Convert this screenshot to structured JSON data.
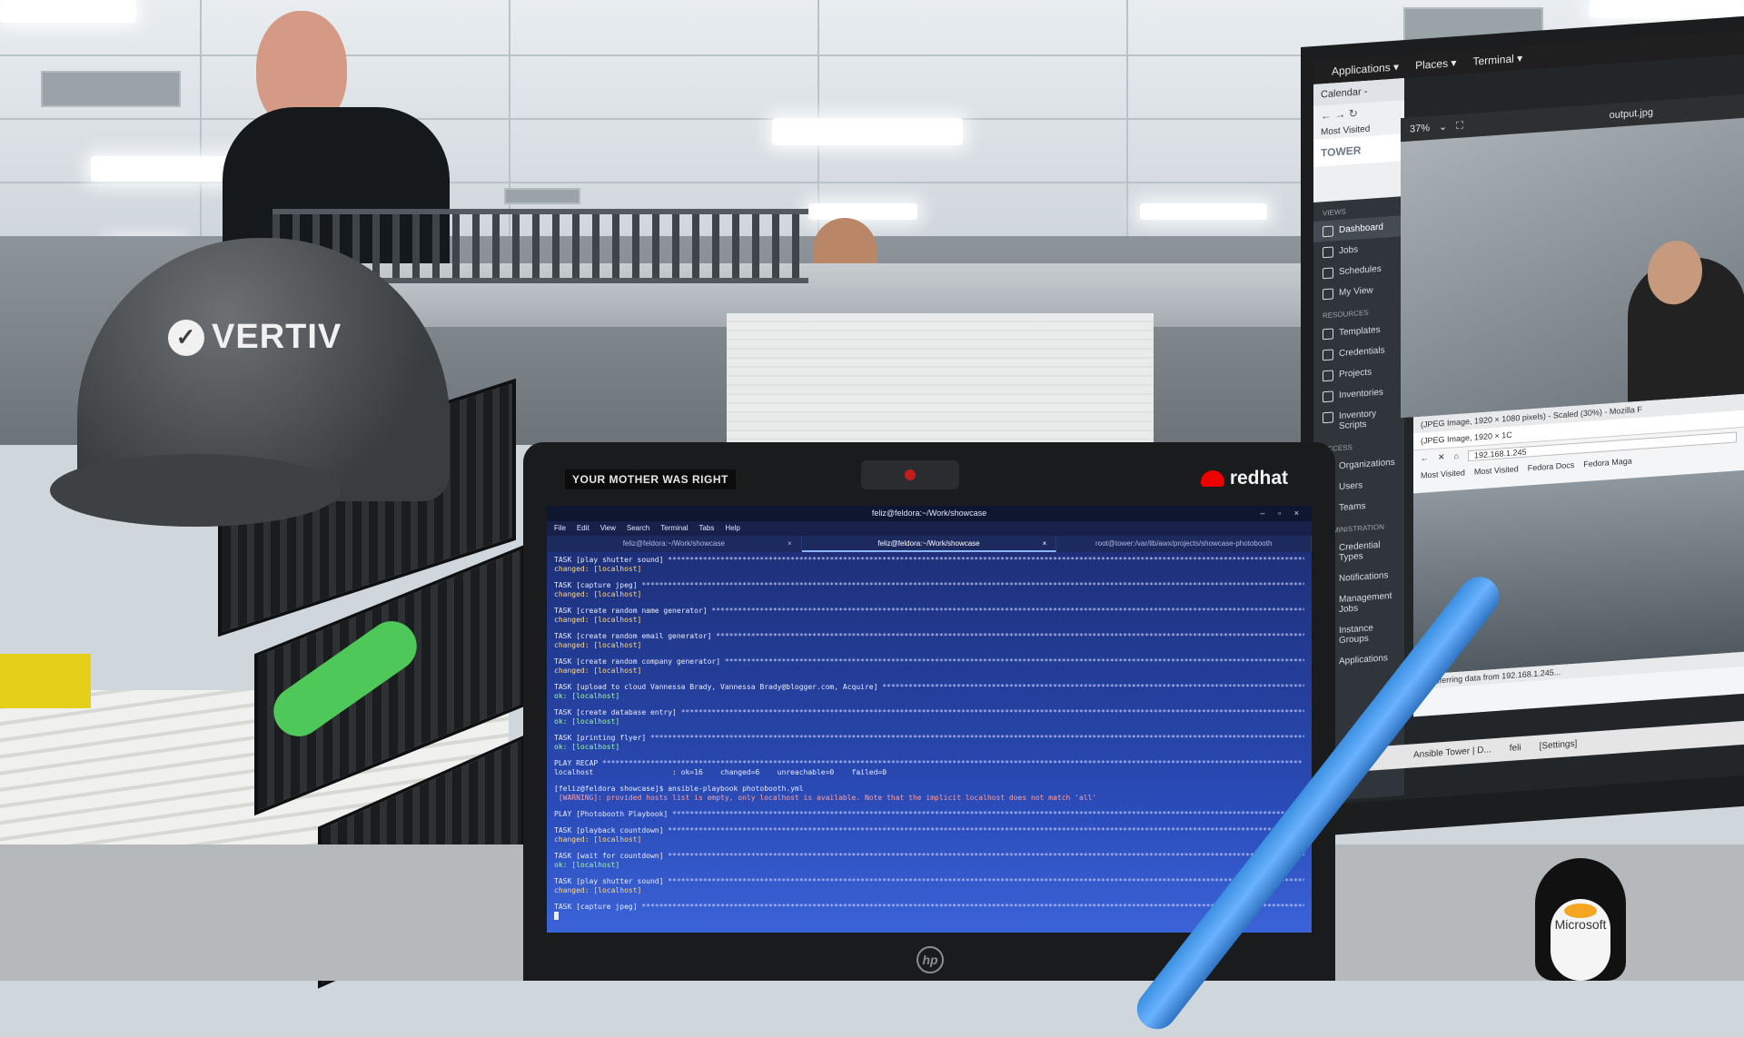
{
  "cap": {
    "brand": "VERTIV"
  },
  "laptop": {
    "sticker": "YOUR MOTHER WAS RIGHT",
    "brand_logo": "redhat",
    "maker_logo": "hp",
    "terminal": {
      "title": "feliz@feldora:~/Work/showcase",
      "window_controls": "– ▫ ×",
      "menu": [
        "File",
        "Edit",
        "View",
        "Search",
        "Terminal",
        "Tabs",
        "Help"
      ],
      "tabs": [
        {
          "label": "feliz@feldora:~/Work/showcase",
          "close": "×"
        },
        {
          "label": "feliz@feldora:~/Work/showcase",
          "close": "×",
          "active": true
        },
        {
          "label": "root@tower:/var/lib/awx/projects/showcase-photobooth",
          "close": ""
        }
      ],
      "lines": [
        {
          "text": "TASK [play shutter sound] ",
          "kind": "task"
        },
        {
          "text": "changed: [localhost]",
          "kind": "changed"
        },
        {
          "text": "",
          "kind": "gap"
        },
        {
          "text": "TASK [capture jpeg] ",
          "kind": "task"
        },
        {
          "text": "changed: [localhost]",
          "kind": "changed"
        },
        {
          "text": "",
          "kind": "gap"
        },
        {
          "text": "TASK [create random name generator] ",
          "kind": "task"
        },
        {
          "text": "changed: [localhost]",
          "kind": "changed"
        },
        {
          "text": "",
          "kind": "gap"
        },
        {
          "text": "TASK [create random email generator] ",
          "kind": "task"
        },
        {
          "text": "changed: [localhost]",
          "kind": "changed"
        },
        {
          "text": "",
          "kind": "gap"
        },
        {
          "text": "TASK [create random company generator] ",
          "kind": "task"
        },
        {
          "text": "changed: [localhost]",
          "kind": "changed"
        },
        {
          "text": "",
          "kind": "gap"
        },
        {
          "text": "TASK [upload to cloud Vannessa Brady, Vannessa Brady@blogger.com, Acquire] ",
          "kind": "task"
        },
        {
          "text": "ok: [localhost]",
          "kind": "ok"
        },
        {
          "text": "",
          "kind": "gap"
        },
        {
          "text": "TASK [create database entry] ",
          "kind": "task"
        },
        {
          "text": "ok: [localhost]",
          "kind": "ok"
        },
        {
          "text": "",
          "kind": "gap"
        },
        {
          "text": "TASK [printing flyer] ",
          "kind": "task"
        },
        {
          "text": "ok: [localhost]",
          "kind": "ok"
        },
        {
          "text": "",
          "kind": "gap"
        },
        {
          "text": "PLAY RECAP ",
          "kind": "task"
        },
        {
          "text": "localhost                  : ok=16    changed=6    unreachable=0    failed=0",
          "kind": "plain"
        },
        {
          "text": "",
          "kind": "gap"
        },
        {
          "text": "[feliz@feldora showcase]$ ansible-playbook photobooth.yml",
          "kind": "plain"
        },
        {
          "text": " [WARNING]: provided hosts list is empty, only localhost is available. Note that the implicit localhost does not match 'all'",
          "kind": "warn"
        },
        {
          "text": "",
          "kind": "gap"
        },
        {
          "text": "PLAY [Photobooth Playbook] ",
          "kind": "task"
        },
        {
          "text": "",
          "kind": "gap"
        },
        {
          "text": "TASK [playback countdown] ",
          "kind": "task"
        },
        {
          "text": "changed: [localhost]",
          "kind": "changed"
        },
        {
          "text": "",
          "kind": "gap"
        },
        {
          "text": "TASK [wait for countdown] ",
          "kind": "task"
        },
        {
          "text": "ok: [localhost]",
          "kind": "ok"
        },
        {
          "text": "",
          "kind": "gap"
        },
        {
          "text": "TASK [play shutter sound] ",
          "kind": "task"
        },
        {
          "text": "changed: [localhost]",
          "kind": "changed"
        },
        {
          "text": "",
          "kind": "gap"
        },
        {
          "text": "TASK [capture jpeg] ",
          "kind": "task"
        }
      ]
    }
  },
  "monitor": {
    "topbar": [
      "Applications ▾",
      "Places ▾",
      "Terminal ▾"
    ],
    "tower": {
      "tab": "Calendar - ",
      "most_visited": "Most Visited",
      "brand": "TOWER",
      "views_header": "VIEWS",
      "views": [
        "Dashboard",
        "Jobs",
        "Schedules",
        "My View"
      ],
      "resources_header": "RESOURCES",
      "resources": [
        "Templates",
        "Credentials",
        "Projects",
        "Inventories",
        "Inventory Scripts"
      ],
      "access_header": "ACCESS",
      "access": [
        "Organizations",
        "Users",
        "Teams"
      ],
      "admin_header": "ADMINISTRATION",
      "admin": [
        "Credential Types",
        "Notifications",
        "Management Jobs",
        "Instance Groups",
        "Applications"
      ]
    },
    "viewer": {
      "zoom": "37%",
      "filename": "output.jpg"
    },
    "firefox": {
      "window_title": "(JPEG Image, 1920 × 1080 pixels) - Scaled (30%) - Mozilla F",
      "tab": "(JPEG Image, 1920 × 1C",
      "url": "192.168.1.245",
      "bookmarks": [
        "Most Visited",
        "Most Visited",
        "Fedora Docs",
        "Fedora Maga"
      ],
      "status": "Transferring data from 192.168.1.245..."
    },
    "taskbar": [
      "Ansible Tower | D...",
      "feli",
      "[Settings]"
    ]
  },
  "tux": {
    "label": "Microsoft"
  }
}
